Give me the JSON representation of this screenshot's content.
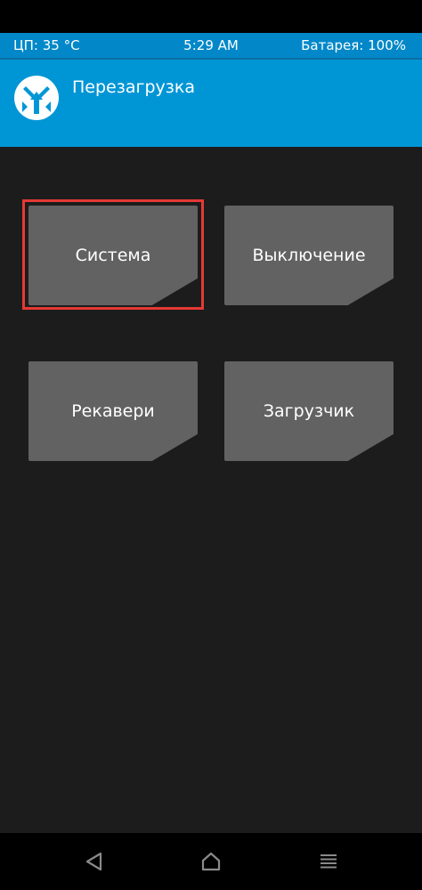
{
  "status_bar": {
    "cpu": "ЦП: 35 °C",
    "time": "5:29 AM",
    "battery": "Батарея: 100%"
  },
  "header": {
    "title": "Перезагрузка",
    "logo_icon": "twrp-logo-icon"
  },
  "reboot_options": [
    {
      "label": "Система",
      "selected": true
    },
    {
      "label": "Выключение",
      "selected": false
    },
    {
      "label": "Рекавери",
      "selected": false
    },
    {
      "label": "Загрузчик",
      "selected": false
    }
  ],
  "navigation": {
    "back_icon": "back-triangle-icon",
    "home_icon": "home-icon",
    "menu_icon": "menu-lines-icon"
  },
  "colors": {
    "header_blue": "#0096d6",
    "status_blue": "#0288c9",
    "background": "#1c1c1c",
    "tile": "#626262",
    "selection": "#e53935"
  }
}
